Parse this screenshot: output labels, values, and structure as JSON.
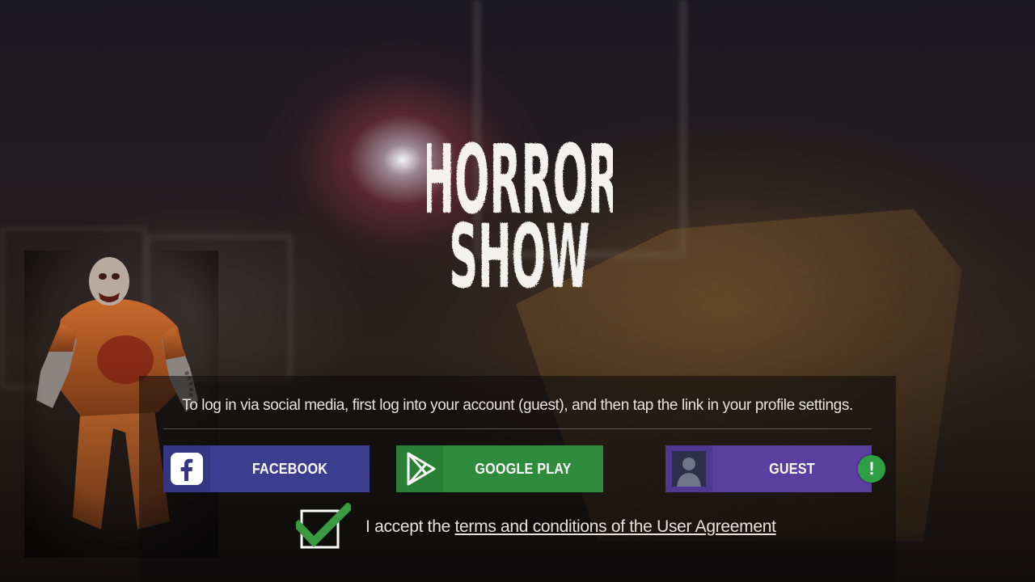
{
  "logo": {
    "line1": "HORROR",
    "line2": "SHOW"
  },
  "login": {
    "info_text": "To log in via social media, first log into your account (guest), and then tap the link in your profile settings.",
    "buttons": [
      {
        "label": "FACEBOOK",
        "icon": "facebook-icon",
        "color": "#3b3d8e"
      },
      {
        "label": "GOOGLE PLAY",
        "icon": "google-play-icon",
        "color": "#2e8b3c"
      },
      {
        "label": "GUEST",
        "icon": "guest-avatar-icon",
        "color": "#5b3fa0"
      }
    ],
    "guest_badge": "!"
  },
  "agreement": {
    "checked": true,
    "prefix": "I accept the",
    "link_text": "terms and conditions of the User Agreement"
  },
  "colors": {
    "facebook": "#3b3d8e",
    "google_play": "#2e8b3c",
    "guest": "#5b3fa0",
    "badge": "#2ea043",
    "checkmark": "#3a9a3f"
  }
}
